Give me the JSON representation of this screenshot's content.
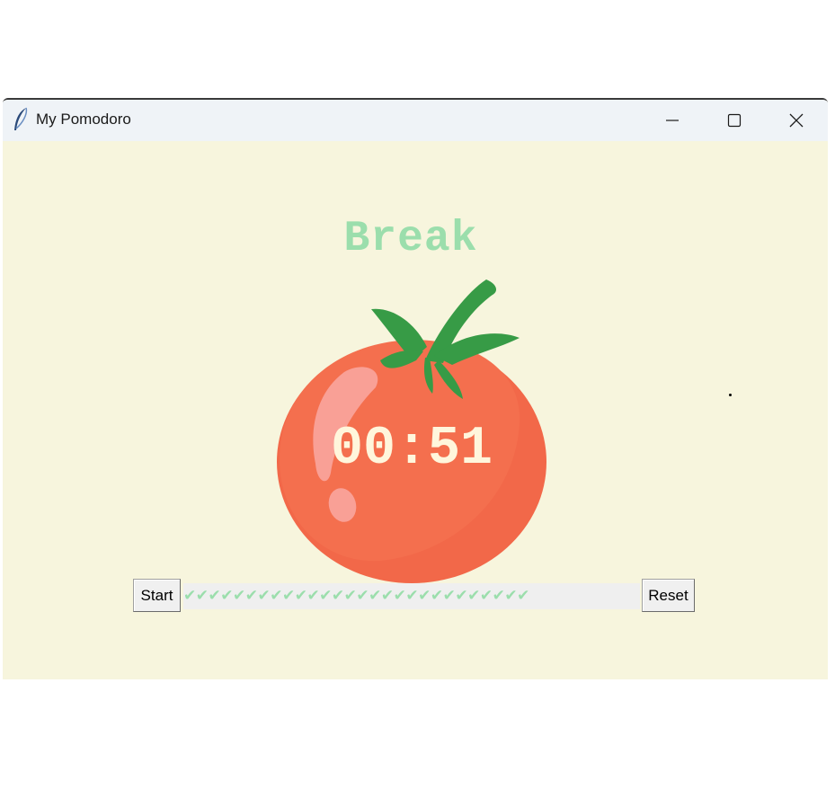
{
  "window": {
    "title": "My Pomodoro",
    "app_icon": "feather-icon",
    "controls": [
      "minimize-icon",
      "maximize-icon",
      "close-icon"
    ]
  },
  "main": {
    "status_label": "Break",
    "timer": "00:51",
    "checkmarks": "✔✔✔✔✔✔✔✔✔✔✔✔✔✔✔✔✔✔✔✔✔✔✔✔✔✔✔✔",
    "start_label": "Start",
    "reset_label": "Reset"
  },
  "colors": {
    "background": "#f7f5dd",
    "accent_green": "#9bdeac",
    "tomato_red": "#f26849",
    "leaf_green": "#379b46",
    "timer_text": "#fff6dc"
  }
}
